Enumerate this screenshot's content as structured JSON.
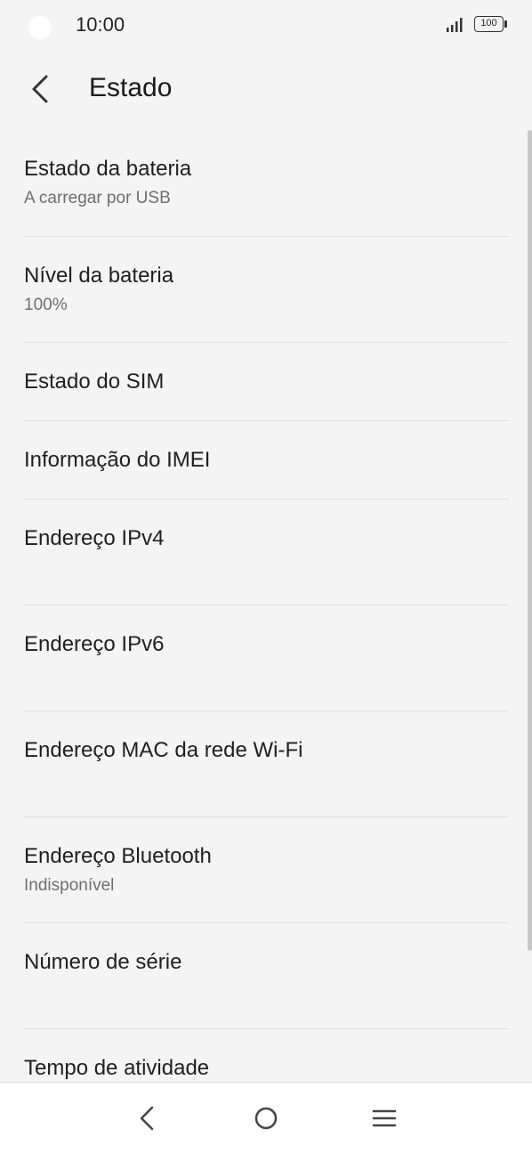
{
  "status_bar": {
    "time": "10:00",
    "battery_level": "100",
    "icons": [
      "camera-cutout",
      "signal-icon",
      "battery-icon"
    ]
  },
  "app_bar": {
    "title": "Estado",
    "back_icon": "chevron-left-icon"
  },
  "items": [
    {
      "title": "Estado da bateria",
      "subtitle": "A carregar por USB"
    },
    {
      "title": "Nível da bateria",
      "subtitle": "100%"
    },
    {
      "title": "Estado do SIM",
      "subtitle": ""
    },
    {
      "title": "Informação do IMEI",
      "subtitle": ""
    },
    {
      "title": "Endereço IPv4",
      "subtitle": ""
    },
    {
      "title": "Endereço IPv6",
      "subtitle": ""
    },
    {
      "title": "Endereço MAC da rede Wi-Fi",
      "subtitle": ""
    },
    {
      "title": "Endereço Bluetooth",
      "subtitle": "Indisponível"
    },
    {
      "title": "Número de série",
      "subtitle": ""
    },
    {
      "title": "Tempo de atividade",
      "subtitle": ""
    }
  ],
  "nav_bar": {
    "icons": [
      "back-icon",
      "home-icon",
      "recents-menu-icon"
    ]
  },
  "colors": {
    "background": "#f4f4f4",
    "divider": "#dedede",
    "secondary_text": "#6e6e6e",
    "nav_background": "#ffffff"
  }
}
